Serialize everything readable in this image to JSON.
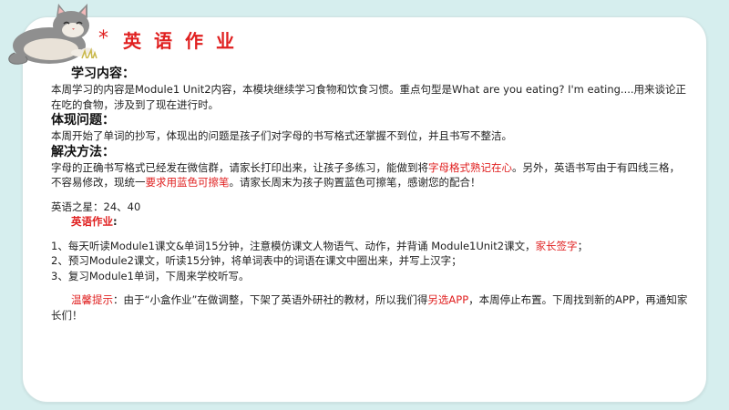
{
  "title": {
    "star": "*",
    "text": "英语作业"
  },
  "sections": {
    "study_heading": "学习内容：",
    "study_text": "本周学习的内容是Module1 Unit2内容，本模块继续学习食物和饮食习惯。重点句型是What are you eating? I'm eating....用来谈论正在吃的食物，涉及到了现在进行时。",
    "problem_heading": "体现问题：",
    "problem_text": "本周开始了单词的抄写，体现出的问题是孩子们对字母的书写格式还掌握不到位，并且书写不整洁。",
    "solution_heading": "解决方法：",
    "solution_text_a": "字母的正确书写格式已经发在微信群，请家长打印出来，让孩子多练习，能做到将",
    "solution_red_a": "字母格式熟记在心",
    "solution_text_b": "。另外，英语书写由于有四线三格，不容易修改，现统一",
    "solution_red_b": "要求用蓝色可擦笔",
    "solution_text_c": "。请家长周末为孩子购置蓝色可擦笔，感谢您的配合！"
  },
  "stars": {
    "label": "英语之星：",
    "value": "24、40"
  },
  "homework": {
    "heading": "英语作业",
    "colon": ":",
    "item1_text": "1、每天听读Module1课文&单词15分钟，注意模仿课文人物语气、动作，并背诵   Module1Unit2课文，",
    "item1_red": "家长签字",
    "item1_end": "；",
    "item2": "2、预习Module2课文，听读15分钟，将单词表中的词语在课文中圈出来，并写上汉字；",
    "item3": "3、复习Module1单词，下周来学校听写。"
  },
  "tip": {
    "label": "温馨提示",
    "text_a": "：由于“小盒作业”在做调整，下架了英语外研社的教材，所以我们得",
    "red": "另选APP",
    "text_b": "，本周停止布置。下周找到新的APP，再通知家长们！"
  },
  "colors": {
    "accent": "#e02020",
    "background": "#d6eeee",
    "card": "#ffffff"
  },
  "icons": {
    "mascot": "cat-icon"
  }
}
